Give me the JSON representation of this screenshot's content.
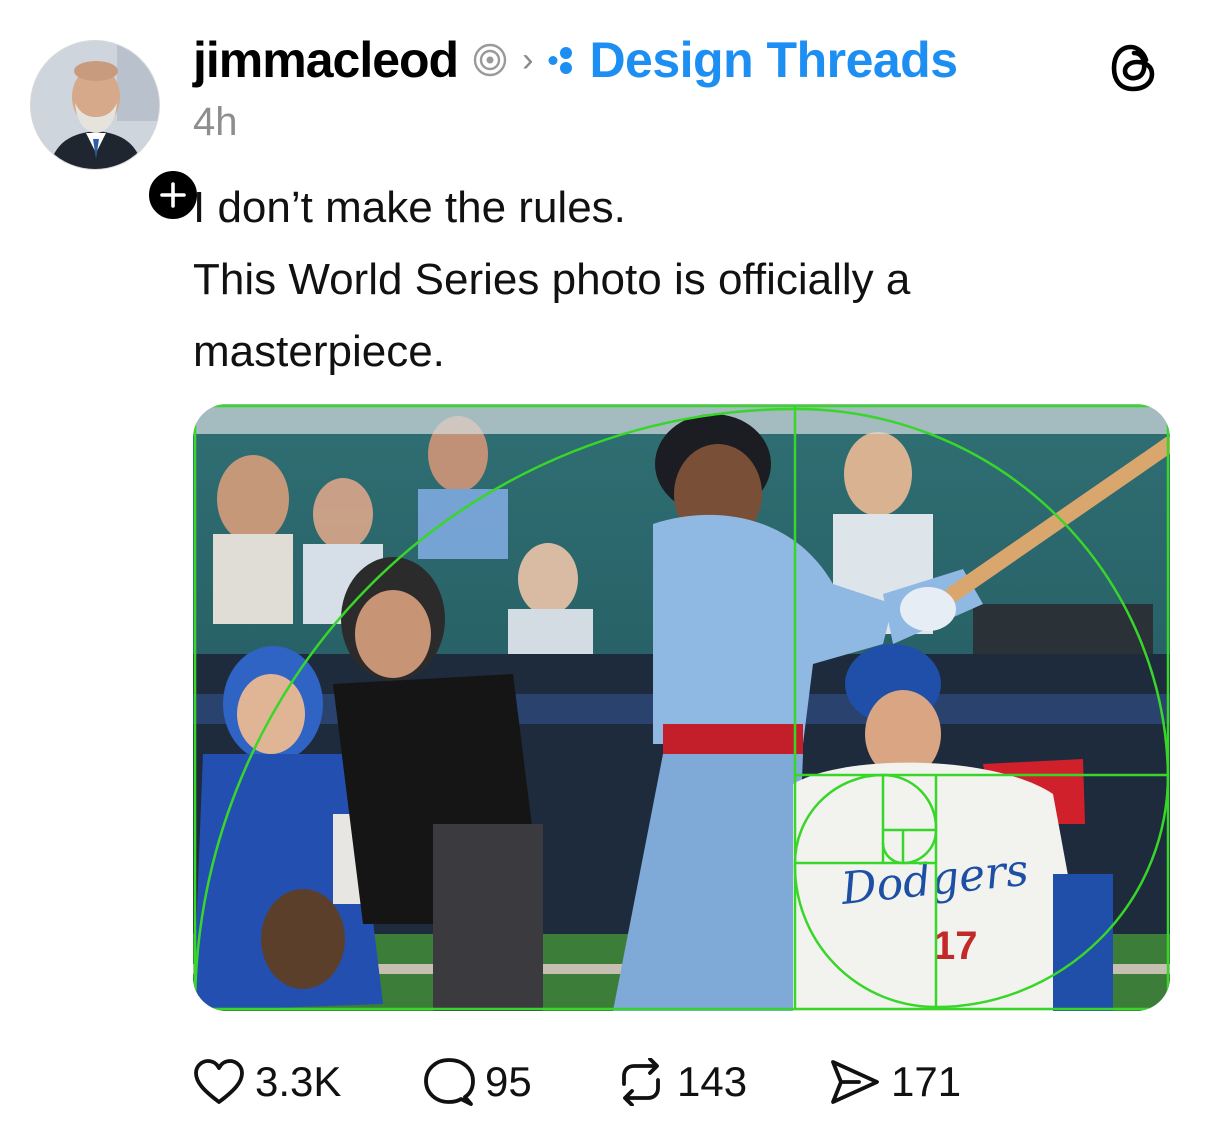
{
  "post": {
    "username": "jimmacleod",
    "community": "Design Threads",
    "timestamp": "4h",
    "text_lines": [
      "I don’t make the rules.",
      "This World Series photo is officially a masterpiece."
    ]
  },
  "photo": {
    "jersey_text": "Dodgers",
    "jersey_number": "17",
    "overlay": "golden-spiral",
    "overlay_color": "#39d62a"
  },
  "actions": {
    "likes": "3.3K",
    "replies": "95",
    "reposts": "143",
    "shares": "171"
  },
  "colors": {
    "accent": "#1d8ff2",
    "muted": "#8e8e8e",
    "badge": "#000000"
  },
  "icons": [
    "verified-icon",
    "chevron-right-icon",
    "community-icon",
    "threads-logo-icon",
    "plus-icon",
    "heart-icon",
    "comment-icon",
    "repost-icon",
    "send-icon"
  ]
}
